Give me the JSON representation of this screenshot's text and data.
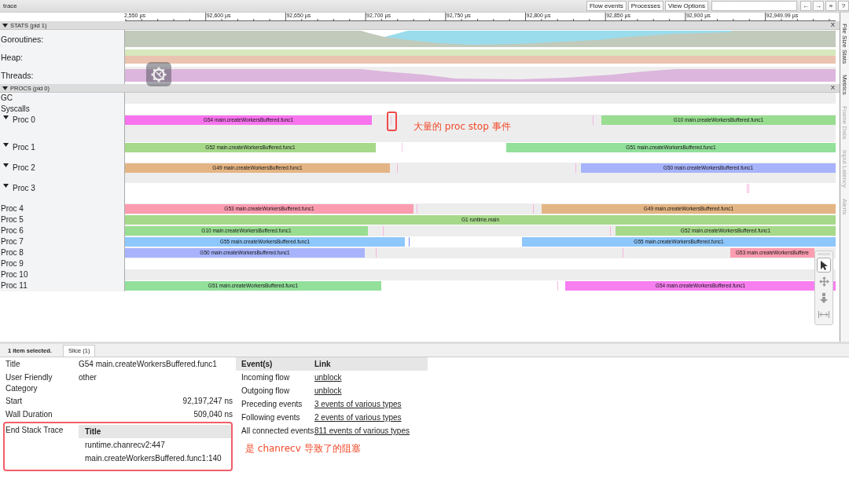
{
  "window": {
    "title": "trace"
  },
  "toolbar": {
    "buttons": [
      "Flow events",
      "Processes",
      "View Options"
    ],
    "nav_buttons": [
      "←",
      "→",
      "»"
    ],
    "help": "?"
  },
  "ruler": {
    "ticks": [
      "2,550 µs",
      "92,600 µs",
      "92,650 µs",
      "92,700 µs",
      "92,750 µs",
      "92,800 µs",
      "92,850 µs",
      "92,900 µs",
      "92,949.99 µs"
    ]
  },
  "stats": {
    "header": "STATS (pid 1)",
    "close": "X",
    "expanded": true,
    "rows": [
      {
        "label": "Goroutines:",
        "kind": "goroutines"
      },
      {
        "label": "Heap:",
        "kind": "heap"
      },
      {
        "label": "Threads:",
        "kind": "threads"
      }
    ]
  },
  "procs": {
    "header": "PROCS (pid 0)",
    "close": "X",
    "expanded": true,
    "rows": [
      {
        "label": "GC",
        "kind": "plain"
      },
      {
        "label": "Syscalls",
        "kind": "plain"
      },
      {
        "label": "Proc 0",
        "kind": "group",
        "expanded": true,
        "note": "大量的 proc stop 事件",
        "slices": [
          {
            "kind": "slice",
            "title": "G54 main.createWorkersBuffered.func1",
            "color": "#f774ee"
          },
          {
            "kind": "marker",
            "color": "#e8c8dc"
          },
          {
            "kind": "marker",
            "color": "#f5b5e0"
          },
          {
            "kind": "slice",
            "title": "G10 main.createWorkersBuffered.func1",
            "color": "#99dd91"
          }
        ]
      },
      {
        "label": "Proc 1",
        "kind": "group",
        "expanded": true,
        "slices": [
          {
            "kind": "slice",
            "title": "G52 main.createWorkersBuffered.func1",
            "color": "#a6d98a"
          },
          {
            "kind": "marker",
            "color": "#fbc6ec"
          },
          {
            "kind": "slice",
            "title": "G51 main.createWorkersBuffered.func1",
            "color": "#92e09a"
          }
        ]
      },
      {
        "label": "Proc 2",
        "kind": "group",
        "expanded": true,
        "slices": [
          {
            "kind": "slice",
            "title": "G49 main.createWorkersBuffered.func1",
            "color": "#e4b584"
          },
          {
            "kind": "marker",
            "color": "#f5b5e0"
          },
          {
            "kind": "marker",
            "color": "#f5b5e0"
          },
          {
            "kind": "slice",
            "title": "G50 main.createWorkersBuffered.func1",
            "color": "#a7b3fb"
          }
        ]
      },
      {
        "label": "Proc 3",
        "kind": "group",
        "expanded": true,
        "slices": [
          {
            "kind": "marker",
            "color": "#f5b5e0"
          },
          {
            "kind": "marker",
            "color": "#f5b5e0"
          }
        ]
      },
      {
        "label": "Proc 4",
        "kind": "plain",
        "slices": [
          {
            "kind": "slice",
            "title": "G53 main.createWorkersBuffered.func1",
            "color": "#fc9cb0"
          },
          {
            "kind": "marker",
            "color": "#f5b5e0"
          },
          {
            "kind": "marker",
            "color": "#f5b5e0"
          },
          {
            "kind": "slice",
            "title": "G49 main.createWorkersBuffered.func1",
            "color": "#e4b584"
          }
        ]
      },
      {
        "label": "Proc 5",
        "kind": "plain",
        "slices": [
          {
            "kind": "slice",
            "title": "G1 runtime.main",
            "color": "#a6d88a"
          }
        ]
      },
      {
        "label": "Proc 6",
        "kind": "plain",
        "slices": [
          {
            "kind": "slice",
            "title": "G10 main.createWorkersBuffered.func1",
            "color": "#99dd91"
          },
          {
            "kind": "marker",
            "color": "#f5b5e0"
          },
          {
            "kind": "marker",
            "color": "#f5b5e0"
          },
          {
            "kind": "slice",
            "title": "G52 main.createWorkersBuffered.func1",
            "color": "#a6d98a"
          }
        ]
      },
      {
        "label": "Proc 7",
        "kind": "plain",
        "slices": [
          {
            "kind": "slice",
            "title": "G55 main.createWorkersBuffered.func1",
            "color": "#8ec7fb"
          },
          {
            "kind": "marker",
            "color": "#7d8ef5"
          },
          {
            "kind": "slice",
            "title": "G55 main.createWorkersBuffered.func1",
            "color": "#8ec7fb"
          }
        ]
      },
      {
        "label": "Proc 8",
        "kind": "plain",
        "slices": [
          {
            "kind": "slice",
            "title": "G50 main.createWorkersBuffered.func1",
            "color": "#a7b3fb"
          },
          {
            "kind": "marker",
            "color": "#f5b5e0"
          },
          {
            "kind": "marker",
            "color": "#f5b5e0"
          },
          {
            "kind": "slice",
            "title": "G53 main.createWorkersBuffere",
            "color": "#fc9cb0"
          }
        ]
      },
      {
        "label": "Proc 9",
        "kind": "plain"
      },
      {
        "label": "Proc 10",
        "kind": "plain"
      },
      {
        "label": "Proc 11",
        "kind": "plain",
        "slices": [
          {
            "kind": "slice",
            "title": "G51 main.createWorkersBuffered.func1",
            "color": "#92e09a"
          },
          {
            "kind": "marker",
            "color": "#f5b5e0"
          },
          {
            "kind": "slice",
            "title": "G54 main.createWorkersBuffered.func1",
            "color": "#f77ff0"
          }
        ]
      }
    ]
  },
  "tools": [
    {
      "kind": "select",
      "selected": true
    },
    {
      "kind": "pan",
      "selected": false
    },
    {
      "kind": "zoom",
      "selected": false
    },
    {
      "kind": "timing",
      "selected": false
    }
  ],
  "side_tabs": [
    {
      "label": "File Size Stats",
      "disabled": false
    },
    {
      "label": "Metrics",
      "disabled": false
    },
    {
      "label": "Frame Data",
      "disabled": true
    },
    {
      "label": "Input Latency",
      "disabled": true
    },
    {
      "label": "Alerts",
      "disabled": true
    }
  ],
  "selection": {
    "summary": "1 item selected.",
    "tabs": [
      {
        "label": "Slice (1)",
        "selected": true
      }
    ],
    "fields": [
      {
        "label": "Title",
        "value": "G54 main.createWorkersBuffered.func1",
        "kind": "text"
      },
      {
        "label": "User Friendly Category",
        "value": "other",
        "kind": "text"
      },
      {
        "label": "Start",
        "value": "92,197,247 ns",
        "kind": "number"
      },
      {
        "label": "Wall Duration",
        "value": "509,040 ns",
        "kind": "number"
      }
    ],
    "stack": {
      "label": "End Stack Trace",
      "header": "Title",
      "frames": [
        "runtime.chanrecv2:447",
        "main.createWorkersBuffered.func1:140"
      ]
    },
    "events": {
      "columns": [
        "Event(s)",
        "Link"
      ],
      "rows": [
        {
          "event": "Incoming flow",
          "link": "unblock"
        },
        {
          "event": "Outgoing flow",
          "link": "unblock"
        },
        {
          "event": "Preceding events",
          "link": "3 events of various types"
        },
        {
          "event": "Following events",
          "link": "2 events of various types"
        },
        {
          "event": "All connected events",
          "link": "811 events of various types"
        }
      ]
    },
    "note": "是 chanrecv 导致了的阻塞"
  }
}
